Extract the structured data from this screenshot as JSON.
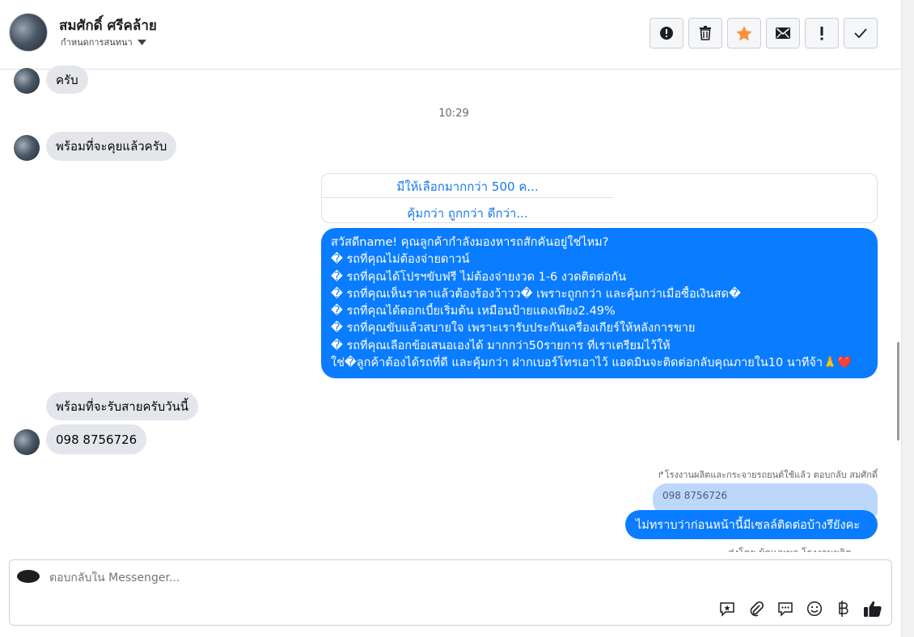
{
  "header": {
    "contact_name": "สมศักดิ์ ศรีคล้าย",
    "assign_label": "กำหนดการสนทนา",
    "actions": [
      "alert-circle-icon",
      "trash-icon",
      "star-icon",
      "envelope-icon",
      "exclamation-icon",
      "check-icon"
    ]
  },
  "messages": {
    "incoming_1": "ครับ",
    "timestamp": "10:29",
    "incoming_2": "พร้อมที่จะคุยแล้วครับ",
    "quick_replies": [
      "มีให้เลือกมากกว่า 500 ค...",
      "คุ้มกว่า ถูกกว่า ดีกว่า..."
    ],
    "outgoing_lines": [
      "สวัสดีname! คุณลูกค้ากำลังมองหารถสักคันอยู่ใช่ไหม?",
      "� รถที่คุณไม่ต้องจ่ายดาวน์",
      "� รถที่คุณได้โปรฯขับฟรี ไม่ต้องจ่ายงวด 1-6 งวดติดต่อกัน",
      "� รถที่คุณเห็นราคาแล้วต้องร้องว้าวว� เพราะถูกกว่า และคุ้มกว่าเมื่อซื้อเงินสด�",
      "� รถที่คุณได้ดอกเบี้ยเริ่มต้น เหมือนป้ายแดงเพียง2.49%",
      "� รถที่คุณขับแล้วสบายใจ เพราะเรารับประกันเครื่องเกียร์ให้หลังการขาย",
      "� รถที่คุณเลือกข้อเสนอเองได้ มากกว่า50รายการ ที่เราเตรียมไว้ให้",
      "ใช่�ลูกค้าต้องได้รถที่ดี และคุ้มกว่า ฝากเบอร์โทรเอาไว้ แอดมินจะติดต่อกลับคุณภายใน10 นาทีจ้า🙏❤️"
    ],
    "incoming_3": "พร้อมที่จะรับสายครับวันนี้",
    "incoming_4": "098  8756726",
    "reply_meta": "↱โรงงานผลิตและกระจายรถยนต์ใช้แล้ว ตอบกลับ สมศักดิ์",
    "quoted_text": "098 8756726",
    "outgoing_2": "ไม่ทราบว่าก่อนหน้านี้มีเซลล์ติดต่อบ้างรึยังคะ",
    "cut_off_text": "ส่งโดย ผู้ดูแลเพจ โรงงานผลิต"
  },
  "composer": {
    "placeholder": "ตอบกลับใน Messenger...",
    "tools": [
      "sticker-icon",
      "paperclip-icon",
      "saved-reply-icon",
      "emoji-icon",
      "baht-icon",
      "thumbs-up-icon"
    ]
  },
  "colors": {
    "accent": "#0a7cff",
    "link": "#1877f2",
    "incoming_bubble": "#e4e6eb",
    "star": "#f7923b"
  }
}
